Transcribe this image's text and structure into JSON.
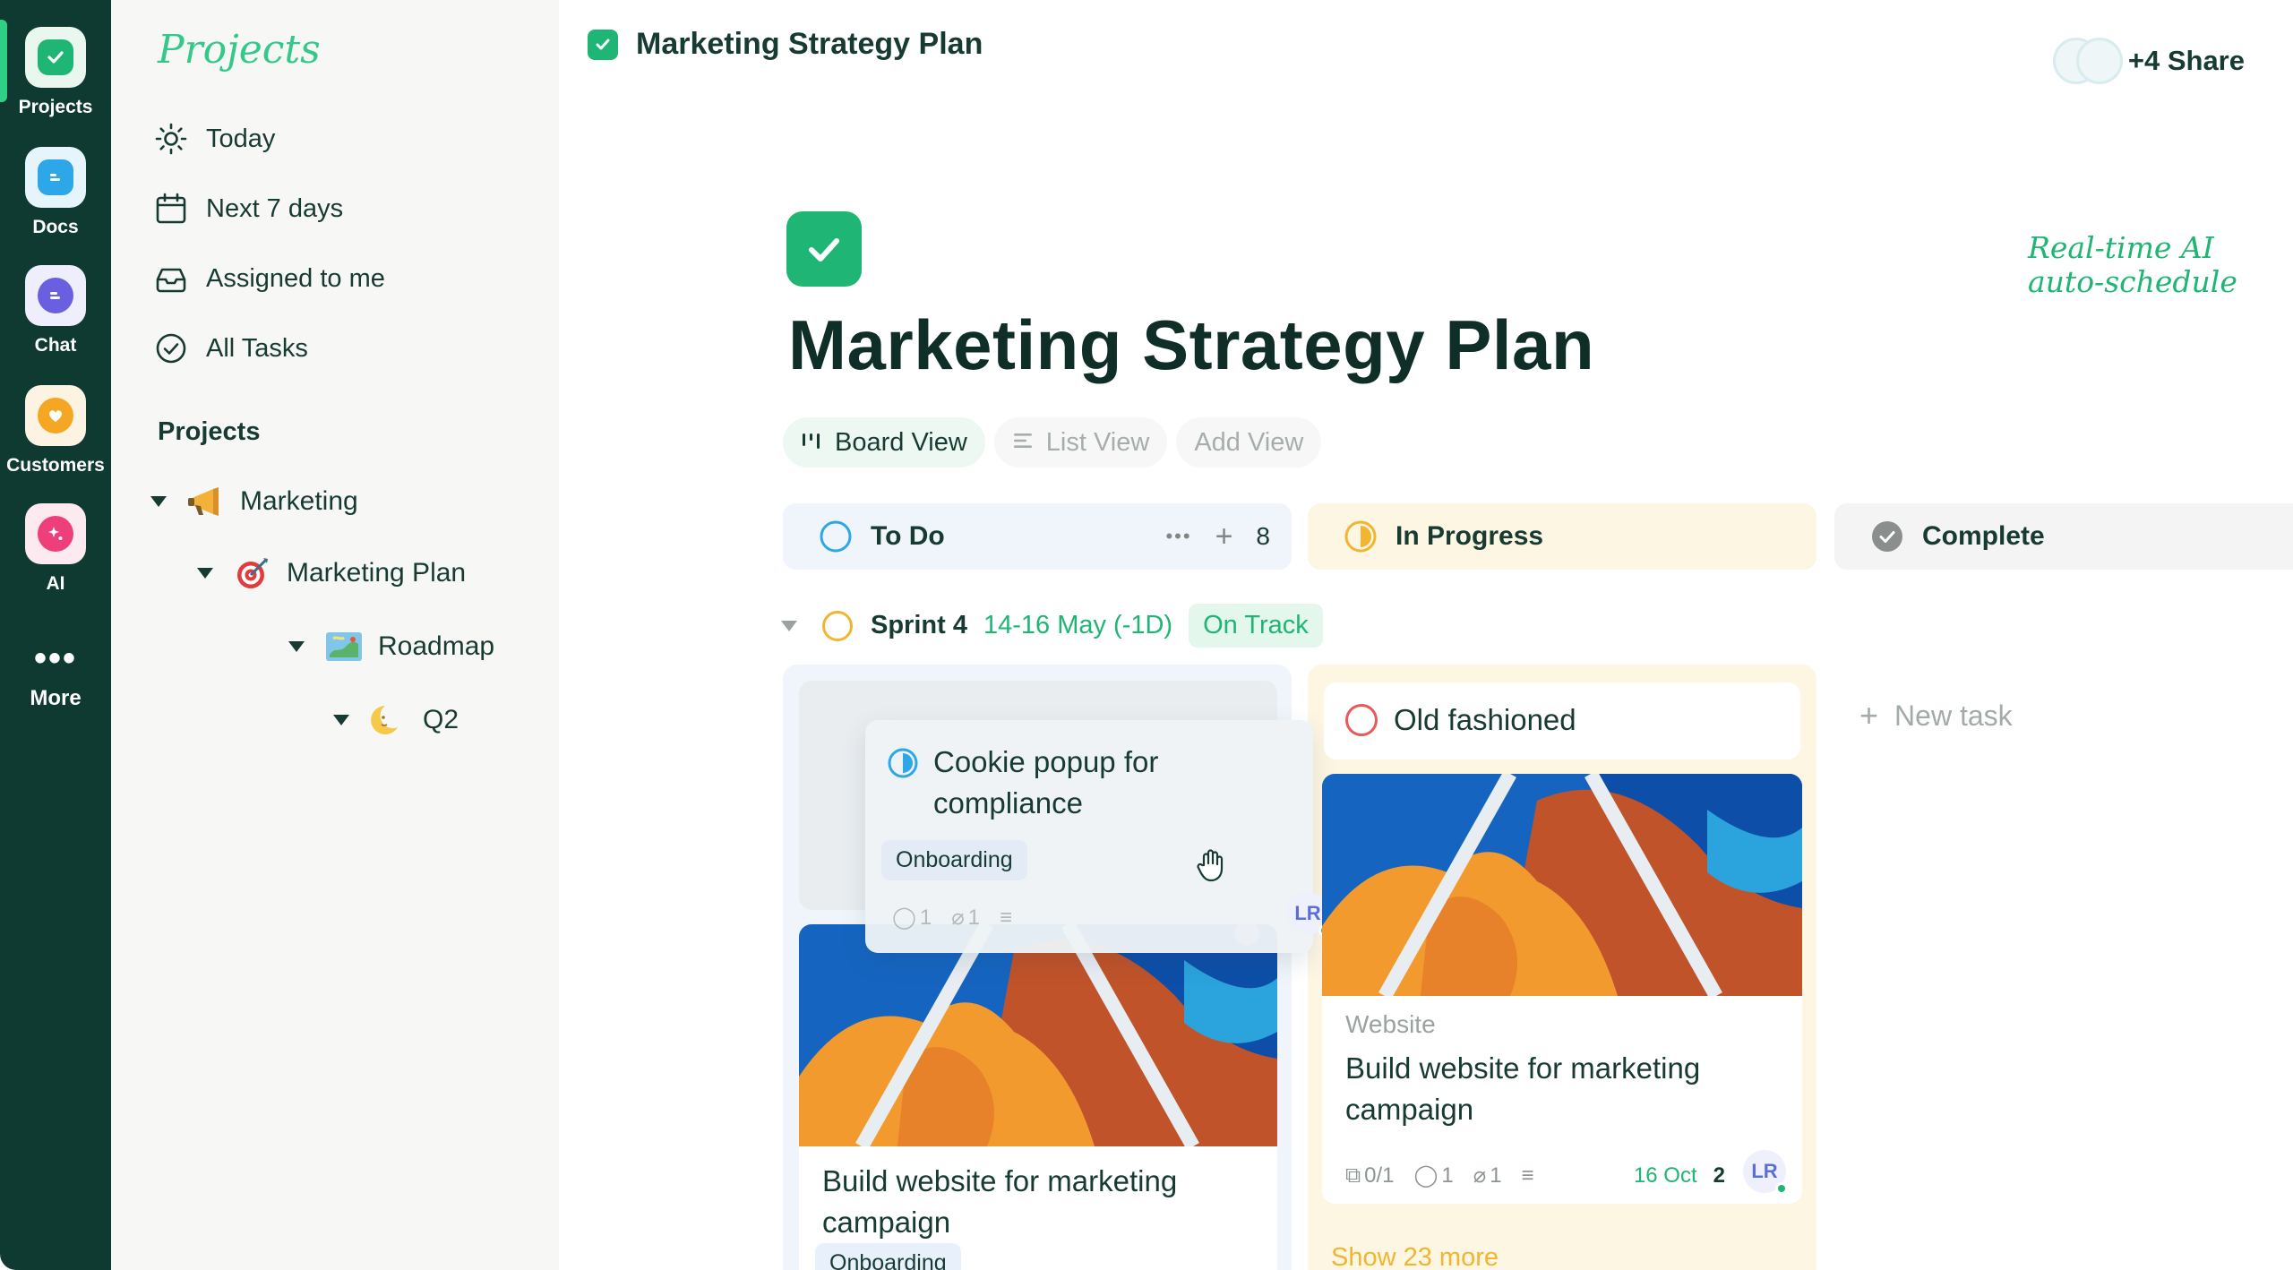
{
  "rail": {
    "items": [
      {
        "label": "Projects"
      },
      {
        "label": "Docs"
      },
      {
        "label": "Chat"
      },
      {
        "label": "Customers"
      },
      {
        "label": "AI"
      },
      {
        "label": "More"
      }
    ]
  },
  "sidebar": {
    "brand": "Projects",
    "nav": [
      {
        "label": "Today",
        "icon": "sun-icon"
      },
      {
        "label": "Next 7 days",
        "icon": "calendar-icon"
      },
      {
        "label": "Assigned to me",
        "icon": "inbox-icon"
      },
      {
        "label": "All Tasks",
        "icon": "check-circle-icon"
      }
    ],
    "section_title": "Projects",
    "tree": [
      {
        "label": "Marketing",
        "icon": "megaphone-icon"
      },
      {
        "label": "Marketing Plan",
        "icon": "target-icon"
      },
      {
        "label": "Roadmap",
        "icon": "map-icon"
      },
      {
        "label": "Q2",
        "icon": "moon-icon"
      }
    ]
  },
  "header": {
    "title": "Marketing Strategy Plan",
    "share": "+4 Share"
  },
  "ai_note": {
    "line1": "Real-time AI",
    "line2": "auto-schedule"
  },
  "page": {
    "title": "Marketing Strategy Plan"
  },
  "views": [
    {
      "label": "Board View",
      "icon": "board-icon",
      "active": true
    },
    {
      "label": "List View",
      "icon": "list-icon",
      "active": false
    },
    {
      "label": "Add View",
      "icon": "",
      "active": false
    }
  ],
  "columns": {
    "todo": {
      "label": "To Do",
      "more": "•••",
      "add": "+",
      "count": "8"
    },
    "inprogress": {
      "label": "In Progress"
    },
    "complete": {
      "label": "Complete"
    }
  },
  "sprint": {
    "name": "Sprint 4",
    "dates": "14-16 May (-1D)",
    "status": "On Track"
  },
  "cards": {
    "dragging": {
      "title": "Cookie popup for compliance",
      "tag": "Onboarding",
      "comments": "1",
      "attachments": "1",
      "assignee": "LR"
    },
    "todo_card": {
      "title": "Build website for marketing campaign",
      "tag": "Onboarding"
    },
    "old_fashioned": {
      "title": "Old fashioned"
    },
    "inprog_card": {
      "category": "Website",
      "title": "Build website for marketing campaign",
      "subtasks": "0/1",
      "comments": "1",
      "attachments": "1",
      "due": "16 Oct",
      "priority": "2",
      "assignee": "LR"
    },
    "show_more": "Show 23 more"
  },
  "complete_lane": {
    "new_task": "New task"
  },
  "colors": {
    "rail_bg": "#0f3a31",
    "accent_green": "#1fb574",
    "todo_bg": "#eff5fa",
    "inprogress_bg": "#fdf6e3",
    "complete_bg": "#f4f4f4"
  }
}
